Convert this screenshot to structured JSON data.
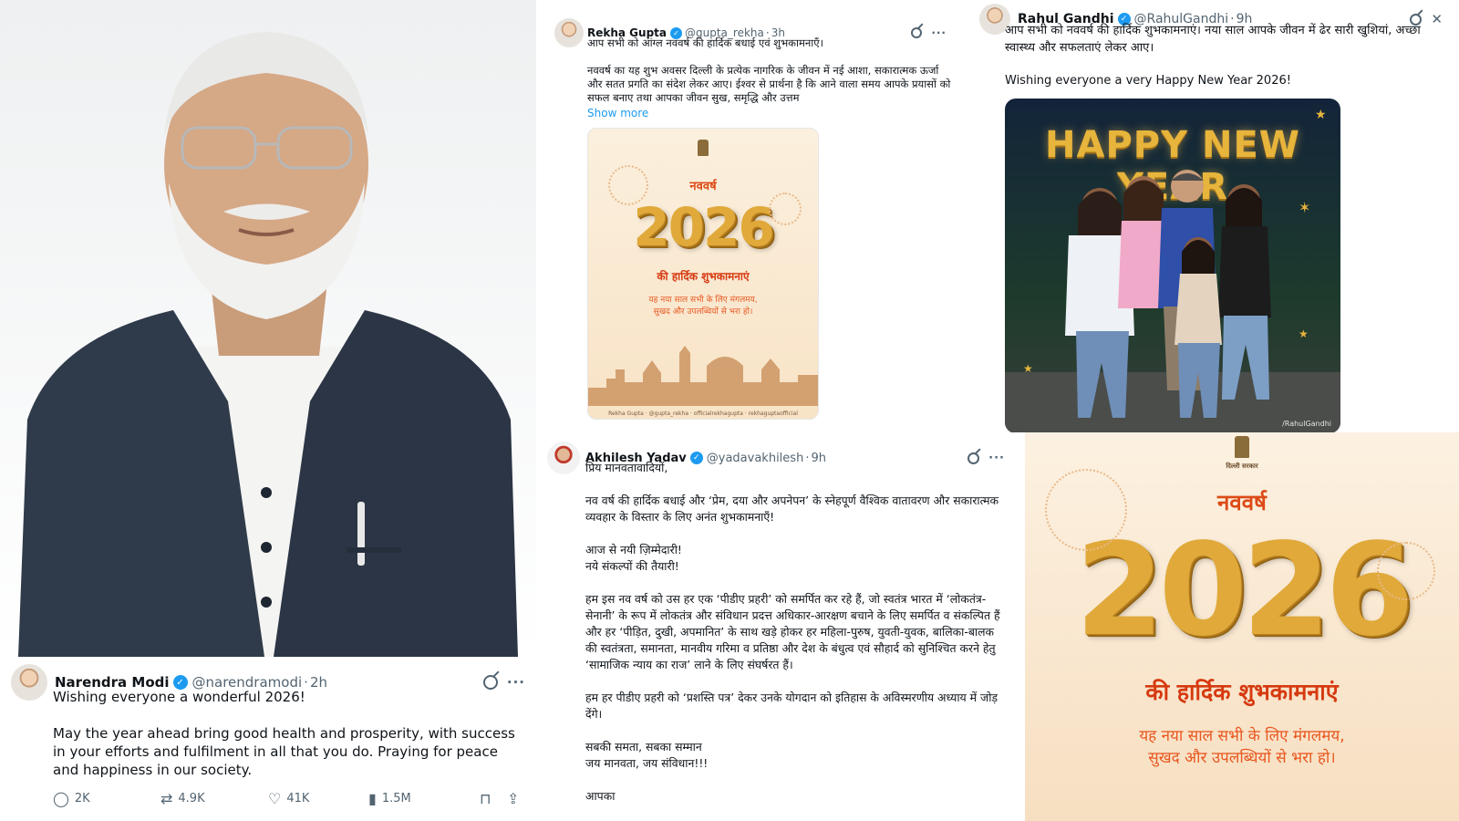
{
  "modi": {
    "name": "Narendra Modi",
    "handle": "@narendramodi",
    "separator": "·",
    "time": "2h",
    "text1": "Wishing everyone a wonderful 2026!",
    "text2": "May the year ahead bring good health and prosperity, with success in your efforts and fulfilment in all that you do. Praying for peace and happiness in our society.",
    "replies": "2K",
    "reposts": "4.9K",
    "likes": "41K",
    "views": "1.5M"
  },
  "rekha": {
    "name": "Rekha Gupta",
    "handle": "@gupta_rekha",
    "separator": "·",
    "time": "3h",
    "text1": "आप सभी को आंग्ल नववर्ष की हार्दिक बधाई एवं शुभकामनाएँ।",
    "text2": "नववर्ष का यह शुभ अवसर दिल्ली के प्रत्येक नागरिक के जीवन में नई आशा, सकारात्मक ऊर्जा और सतत प्रगति का संदेश लेकर आए। ईश्वर से प्रार्थना है कि आने वाला समय आपके प्रयासों को सफल बनाए तथा आपका जीवन सुख, समृद्धि और उत्तम",
    "show_more": "Show more",
    "card": {
      "title": "नववर्ष",
      "year": "2026",
      "subtitle": "की हार्दिक शुभकामनाएं",
      "message": "यह नया साल सभी के लिए मंगलमय,\nसुखद और उपलब्धियों से भरा हो।",
      "footer": "Rekha Gupta · @gupta_rekha · officialrekhagupta · rekhaguptaofficial"
    }
  },
  "rahul": {
    "name": "Rahul Gandhi",
    "handle": "@RahulGandhi",
    "separator": "·",
    "time": "9h",
    "text1": "आप सभी को नववर्ष की हार्दिक शुभकामनाएं। नया साल आपके जीवन में ढेर सारी खुशियां, अच्छा स्वास्थ्य और सफलताएं लेकर आए।",
    "text2": "Wishing everyone a very Happy New Year 2026!",
    "card": {
      "headline": "HAPPY NEW YEAR",
      "credit": "/RahulGandhi"
    }
  },
  "akhilesh": {
    "name": "Akhilesh Yadav",
    "handle": "@yadavakhilesh",
    "separator": "·",
    "time": "9h",
    "paragraphs": [
      "प्रिय मानवतावादियों,",
      "नव वर्ष की हार्दिक बधाई और ‘प्रेम, दया और अपनेपन’ के स्नेहपूर्ण वैश्विक वातावरण और सकारात्मक व्यवहार के विस्तार के लिए अनंत शुभकामनाएँ!",
      "आज से नयी ज़िम्मेदारी!\nनये संकल्पों की तैयारी!",
      "हम इस नव वर्ष को उस हर एक ‘पीडीए प्रहरी’ को समर्पित कर रहे हैं, जो स्वतंत्र भारत में ‘लोकतंत्र-सेनानी’ के रूप में लोकतंत्र और संविधान प्रदत्त अधिकार-आरक्षण बचाने के लिए समर्पित व संकल्पित हैं और हर ‘पीड़ित, दुखी, अपमानित’ के साथ खड़े होकर हर महिला-पुरुष, युवती-युवक, बालिका-बालक की स्वतंत्रता, समानता, मानवीय गरिमा व प्रतिष्ठा और देश के बंधुत्व एवं सौहार्द को सुनिश्चित करने हेतु ‘सामाजिक न्याय का राज’ लाने के लिए संघर्षरत हैं।",
      "हम हर पीडीए प्रहरी को ‘प्रशस्ति पत्र’ देकर उनके योगदान को इतिहास के अविस्मरणीय अध्याय में जोड़ देंगे।",
      "सबकी समता, सबका सम्मान\nजय मानवता, जय संविधान!!!",
      "आपका"
    ]
  },
  "big_card": {
    "emblem_caption": "दिल्ली सरकार",
    "title": "नववर्ष",
    "year": "2026",
    "subtitle": "की हार्दिक शुभकामनाएं",
    "message": "यह नया साल सभी के लिए मंगलमय,\nसुखद और उपलब्धियों से भरा हो।"
  },
  "icons": [
    "verified-icon",
    "grok-icon",
    "more-icon",
    "reply-icon",
    "repost-icon",
    "like-icon",
    "views-icon",
    "bookmark-icon",
    "share-icon"
  ],
  "colors": {
    "verified": "#1d9bf0",
    "link": "#1d9bf0",
    "muted": "#536471",
    "greeting_orange": "#dc4a16",
    "gold": "#e0a93a"
  }
}
